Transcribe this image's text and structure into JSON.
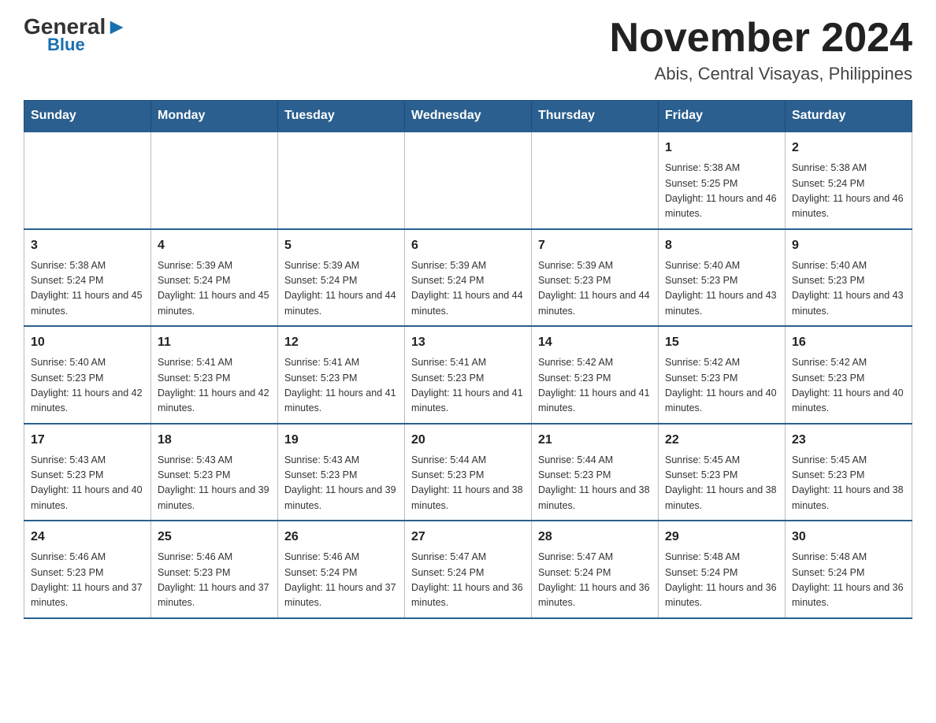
{
  "header": {
    "logo_general": "General",
    "logo_blue": "Blue",
    "month_title": "November 2024",
    "location": "Abis, Central Visayas, Philippines"
  },
  "days_of_week": [
    "Sunday",
    "Monday",
    "Tuesday",
    "Wednesday",
    "Thursday",
    "Friday",
    "Saturday"
  ],
  "weeks": [
    [
      {
        "day": "",
        "info": ""
      },
      {
        "day": "",
        "info": ""
      },
      {
        "day": "",
        "info": ""
      },
      {
        "day": "",
        "info": ""
      },
      {
        "day": "",
        "info": ""
      },
      {
        "day": "1",
        "info": "Sunrise: 5:38 AM\nSunset: 5:25 PM\nDaylight: 11 hours and 46 minutes."
      },
      {
        "day": "2",
        "info": "Sunrise: 5:38 AM\nSunset: 5:24 PM\nDaylight: 11 hours and 46 minutes."
      }
    ],
    [
      {
        "day": "3",
        "info": "Sunrise: 5:38 AM\nSunset: 5:24 PM\nDaylight: 11 hours and 45 minutes."
      },
      {
        "day": "4",
        "info": "Sunrise: 5:39 AM\nSunset: 5:24 PM\nDaylight: 11 hours and 45 minutes."
      },
      {
        "day": "5",
        "info": "Sunrise: 5:39 AM\nSunset: 5:24 PM\nDaylight: 11 hours and 44 minutes."
      },
      {
        "day": "6",
        "info": "Sunrise: 5:39 AM\nSunset: 5:24 PM\nDaylight: 11 hours and 44 minutes."
      },
      {
        "day": "7",
        "info": "Sunrise: 5:39 AM\nSunset: 5:23 PM\nDaylight: 11 hours and 44 minutes."
      },
      {
        "day": "8",
        "info": "Sunrise: 5:40 AM\nSunset: 5:23 PM\nDaylight: 11 hours and 43 minutes."
      },
      {
        "day": "9",
        "info": "Sunrise: 5:40 AM\nSunset: 5:23 PM\nDaylight: 11 hours and 43 minutes."
      }
    ],
    [
      {
        "day": "10",
        "info": "Sunrise: 5:40 AM\nSunset: 5:23 PM\nDaylight: 11 hours and 42 minutes."
      },
      {
        "day": "11",
        "info": "Sunrise: 5:41 AM\nSunset: 5:23 PM\nDaylight: 11 hours and 42 minutes."
      },
      {
        "day": "12",
        "info": "Sunrise: 5:41 AM\nSunset: 5:23 PM\nDaylight: 11 hours and 41 minutes."
      },
      {
        "day": "13",
        "info": "Sunrise: 5:41 AM\nSunset: 5:23 PM\nDaylight: 11 hours and 41 minutes."
      },
      {
        "day": "14",
        "info": "Sunrise: 5:42 AM\nSunset: 5:23 PM\nDaylight: 11 hours and 41 minutes."
      },
      {
        "day": "15",
        "info": "Sunrise: 5:42 AM\nSunset: 5:23 PM\nDaylight: 11 hours and 40 minutes."
      },
      {
        "day": "16",
        "info": "Sunrise: 5:42 AM\nSunset: 5:23 PM\nDaylight: 11 hours and 40 minutes."
      }
    ],
    [
      {
        "day": "17",
        "info": "Sunrise: 5:43 AM\nSunset: 5:23 PM\nDaylight: 11 hours and 40 minutes."
      },
      {
        "day": "18",
        "info": "Sunrise: 5:43 AM\nSunset: 5:23 PM\nDaylight: 11 hours and 39 minutes."
      },
      {
        "day": "19",
        "info": "Sunrise: 5:43 AM\nSunset: 5:23 PM\nDaylight: 11 hours and 39 minutes."
      },
      {
        "day": "20",
        "info": "Sunrise: 5:44 AM\nSunset: 5:23 PM\nDaylight: 11 hours and 38 minutes."
      },
      {
        "day": "21",
        "info": "Sunrise: 5:44 AM\nSunset: 5:23 PM\nDaylight: 11 hours and 38 minutes."
      },
      {
        "day": "22",
        "info": "Sunrise: 5:45 AM\nSunset: 5:23 PM\nDaylight: 11 hours and 38 minutes."
      },
      {
        "day": "23",
        "info": "Sunrise: 5:45 AM\nSunset: 5:23 PM\nDaylight: 11 hours and 38 minutes."
      }
    ],
    [
      {
        "day": "24",
        "info": "Sunrise: 5:46 AM\nSunset: 5:23 PM\nDaylight: 11 hours and 37 minutes."
      },
      {
        "day": "25",
        "info": "Sunrise: 5:46 AM\nSunset: 5:23 PM\nDaylight: 11 hours and 37 minutes."
      },
      {
        "day": "26",
        "info": "Sunrise: 5:46 AM\nSunset: 5:24 PM\nDaylight: 11 hours and 37 minutes."
      },
      {
        "day": "27",
        "info": "Sunrise: 5:47 AM\nSunset: 5:24 PM\nDaylight: 11 hours and 36 minutes."
      },
      {
        "day": "28",
        "info": "Sunrise: 5:47 AM\nSunset: 5:24 PM\nDaylight: 11 hours and 36 minutes."
      },
      {
        "day": "29",
        "info": "Sunrise: 5:48 AM\nSunset: 5:24 PM\nDaylight: 11 hours and 36 minutes."
      },
      {
        "day": "30",
        "info": "Sunrise: 5:48 AM\nSunset: 5:24 PM\nDaylight: 11 hours and 36 minutes."
      }
    ]
  ]
}
